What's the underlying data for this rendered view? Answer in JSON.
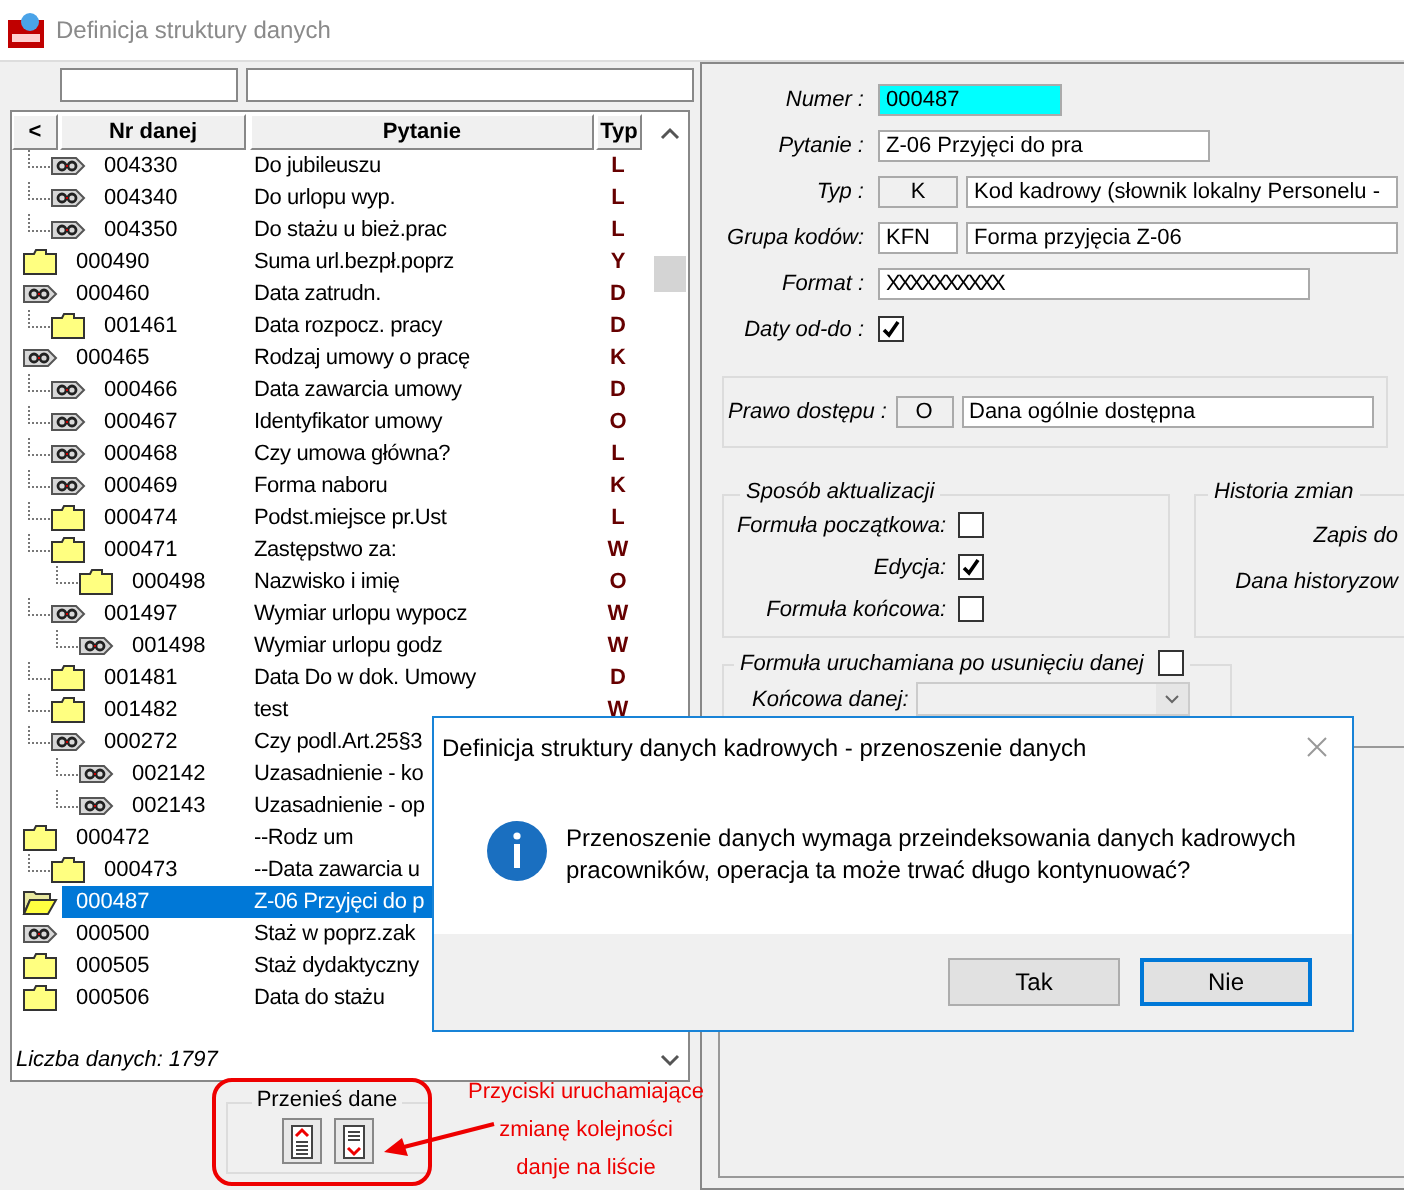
{
  "window": {
    "title": "Definicja struktury danych"
  },
  "list": {
    "columns": [
      "<",
      "Nr danej",
      "Pytanie",
      "Typ"
    ],
    "continued_rows": [
      {
        "number": "004330",
        "question": "Do jubileuszu",
        "type": "L",
        "kind": "tag",
        "selected": false
      },
      {
        "number": "004340",
        "question": "Do urlopu wyp.",
        "type": "L",
        "kind": "tag",
        "selected": false
      },
      {
        "number": "004350",
        "question": "Do stażu u bież.prac",
        "type": "L",
        "kind": "tag",
        "selected": false
      }
    ],
    "rows": [
      {
        "number": "000490",
        "question": "Suma url.bezpł.poprz",
        "type": "Y",
        "kind": "folder",
        "selected": false
      },
      {
        "number": "000460",
        "question": "Data zatrudn.",
        "type": "D",
        "kind": "tag",
        "selected": false,
        "children": [
          {
            "number": "001461",
            "question": "Data rozpocz. pracy",
            "type": "D",
            "kind": "folder",
            "selected": false
          }
        ]
      },
      {
        "number": "000465",
        "question": "Rodzaj umowy o pracę",
        "type": "K",
        "kind": "tag",
        "selected": false,
        "children": [
          {
            "number": "000466",
            "question": "Data zawarcia umowy",
            "type": "D",
            "kind": "tag",
            "selected": false
          },
          {
            "number": "000467",
            "question": "Identyfikator umowy",
            "type": "O",
            "kind": "tag",
            "selected": false
          },
          {
            "number": "000468",
            "question": "Czy umowa główna?",
            "type": "L",
            "kind": "tag",
            "selected": false
          },
          {
            "number": "000469",
            "question": "Forma naboru",
            "type": "K",
            "kind": "tag",
            "selected": false
          },
          {
            "number": "000474",
            "question": "Podst.miejsce pr.Ust",
            "type": "L",
            "kind": "folder",
            "selected": false
          },
          {
            "number": "000471",
            "question": "Zastępstwo za:",
            "type": "W",
            "kind": "folder",
            "selected": false,
            "children": [
              {
                "number": "000498",
                "question": "Nazwisko i imię",
                "type": "O",
                "kind": "folder",
                "selected": false
              }
            ]
          },
          {
            "number": "001497",
            "question": "Wymiar urlopu wypocz",
            "type": "W",
            "kind": "tag",
            "selected": false,
            "children": [
              {
                "number": "001498",
                "question": "Wymiar urlopu godz",
                "type": "W",
                "kind": "tag",
                "selected": false
              }
            ]
          },
          {
            "number": "001481",
            "question": "Data Do w dok. Umowy",
            "type": "D",
            "kind": "folder",
            "selected": false
          },
          {
            "number": "001482",
            "question": "test",
            "type": "W",
            "kind": "folder",
            "selected": false
          },
          {
            "number": "000272",
            "question": "Czy podl.Art.25§3",
            "kind": "tag",
            "selected": false,
            "children": [
              {
                "number": "002142",
                "question": "Uzasadnienie - ko",
                "kind": "tag",
                "selected": false
              },
              {
                "number": "002143",
                "question": "Uzasadnienie - op",
                "kind": "tag",
                "selected": false
              }
            ]
          }
        ]
      },
      {
        "number": "000472",
        "question": "--Rodz um",
        "kind": "folder",
        "selected": false,
        "children": [
          {
            "number": "000473",
            "question": "--Data zawarcia u",
            "kind": "folder",
            "selected": false
          }
        ]
      },
      {
        "number": "000487",
        "question": "Z-06 Przyjęci do p",
        "kind": "folder",
        "selected": true
      },
      {
        "number": "000500",
        "question": "Staż w poprz.zak",
        "kind": "tag",
        "selected": false
      },
      {
        "number": "000505",
        "question": "Staż dydaktyczny",
        "kind": "folder",
        "selected": false
      },
      {
        "number": "000506",
        "question": "Data do stażu",
        "kind": "folder",
        "selected": false
      }
    ],
    "count_label": "Liczba danych: 1797"
  },
  "move_group": {
    "title": "Przenieś dane"
  },
  "form": {
    "fields": [
      {
        "kind": "value",
        "label": "Numer :",
        "value": "000487",
        "highlight": true
      },
      {
        "kind": "value",
        "label": "Pytanie :",
        "value": "Z-06 Przyjęci do pra",
        "highlight": false
      },
      {
        "kind": "code",
        "label": "Typ :",
        "code": "K",
        "description": "Kod kadrowy (słownik lokalny Personelu -",
        "editable": false
      },
      {
        "kind": "code",
        "label": "Grupa kodów:",
        "code": "KFN",
        "description": "Forma przyjęcia Z-06",
        "editable": true
      },
      {
        "kind": "format",
        "label": "Format :",
        "value": "XXXXXXXXXX"
      },
      {
        "kind": "checkbox",
        "label": "Daty od-do :",
        "checked": true
      }
    ],
    "access": {
      "label": "Prawo dostępu :",
      "code": "O",
      "description": "Dana ogólnie dostępna"
    },
    "update_mode": {
      "title": "Sposób aktualizacji",
      "options": [
        {
          "label": "Formuła początkowa:",
          "checked": false
        },
        {
          "label": "Edycja:",
          "checked": true
        },
        {
          "label": "Formuła końcowa:",
          "checked": false
        }
      ]
    },
    "history": {
      "title": "Historia zmian",
      "labels": [
        "Zapis do",
        "Dana historyzow"
      ]
    },
    "delete_formula": {
      "title": "Formuła uruchamiana po usunięciu danej",
      "checked": false,
      "combo_label": "Końcowa danej:",
      "disabled": true
    }
  },
  "dialog": {
    "title": "Definicja struktury danych kadrowych - przenoszenie danych",
    "message_lines": [
      "Przenoszenie danych wymaga przeindeksowania danych kadrowych",
      "pracowników, operacja ta może trwać długo kontynuować?"
    ],
    "buttons": [
      {
        "label": "Tak",
        "focused": false
      },
      {
        "label": "Nie",
        "focused": true
      }
    ]
  },
  "annotation": {
    "lines": [
      "Przyciski uruchamiające",
      "zmianę kolejności",
      "danje na liście"
    ]
  }
}
